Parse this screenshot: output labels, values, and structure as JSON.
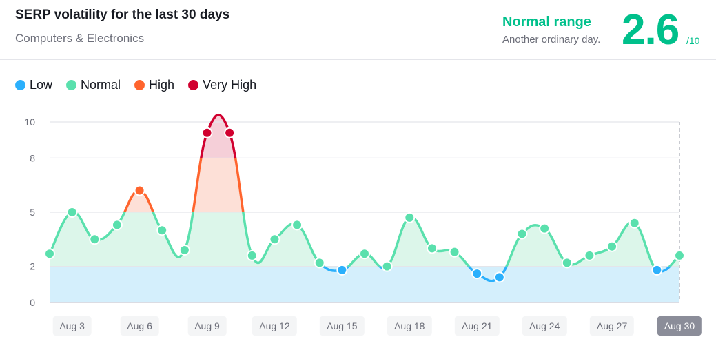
{
  "header": {
    "title": "SERP volatility for the last 30 days",
    "subtitle": "Computers & Electronics",
    "status_title": "Normal range",
    "status_subtitle": "Another ordinary day.",
    "score": "2.6",
    "score_max": "/10"
  },
  "colors": {
    "low": "#2bb0fc",
    "normal": "#5ae0ad",
    "high": "#ff642d",
    "very_high": "#d1002f",
    "low_fill": "#d4effc",
    "normal_fill": "#dcf6ea",
    "high_fill": "#fde0d7",
    "very_high_fill": "#f5cfd8",
    "accent": "#00c08b"
  },
  "chart_data": {
    "type": "line",
    "title": "SERP volatility for the last 30 days",
    "xlabel": "",
    "ylabel": "",
    "ylim": [
      0,
      10
    ],
    "yticks": [
      0,
      2,
      5,
      8,
      10
    ],
    "grid": true,
    "legend": {
      "position": "top-left",
      "entries": [
        "Low",
        "Normal",
        "High",
        "Very High"
      ]
    },
    "thresholds": {
      "low_max": 2,
      "normal_max": 5,
      "high_max": 8,
      "very_high_max": 10
    },
    "x": [
      "Aug 2",
      "Aug 3",
      "Aug 4",
      "Aug 5",
      "Aug 6",
      "Aug 7",
      "Aug 8",
      "Aug 9",
      "Aug 10",
      "Aug 11",
      "Aug 12",
      "Aug 13",
      "Aug 14",
      "Aug 15",
      "Aug 16",
      "Aug 17",
      "Aug 18",
      "Aug 19",
      "Aug 20",
      "Aug 21",
      "Aug 22",
      "Aug 23",
      "Aug 24",
      "Aug 25",
      "Aug 26",
      "Aug 27",
      "Aug 28",
      "Aug 29",
      "Aug 30"
    ],
    "values": [
      2.7,
      5.0,
      3.5,
      4.3,
      6.2,
      4.0,
      2.9,
      9.4,
      9.4,
      2.6,
      3.5,
      4.3,
      2.2,
      1.8,
      2.7,
      2.0,
      4.7,
      3.0,
      2.8,
      1.6,
      1.4,
      3.8,
      4.1,
      2.2,
      2.6,
      3.1,
      4.4,
      1.8,
      2.6
    ],
    "xtick_labels": [
      "Aug 3",
      "Aug 6",
      "Aug 9",
      "Aug 12",
      "Aug 15",
      "Aug 18",
      "Aug 21",
      "Aug 24",
      "Aug 27",
      "Aug 30"
    ],
    "selected_label": "Aug 30"
  }
}
